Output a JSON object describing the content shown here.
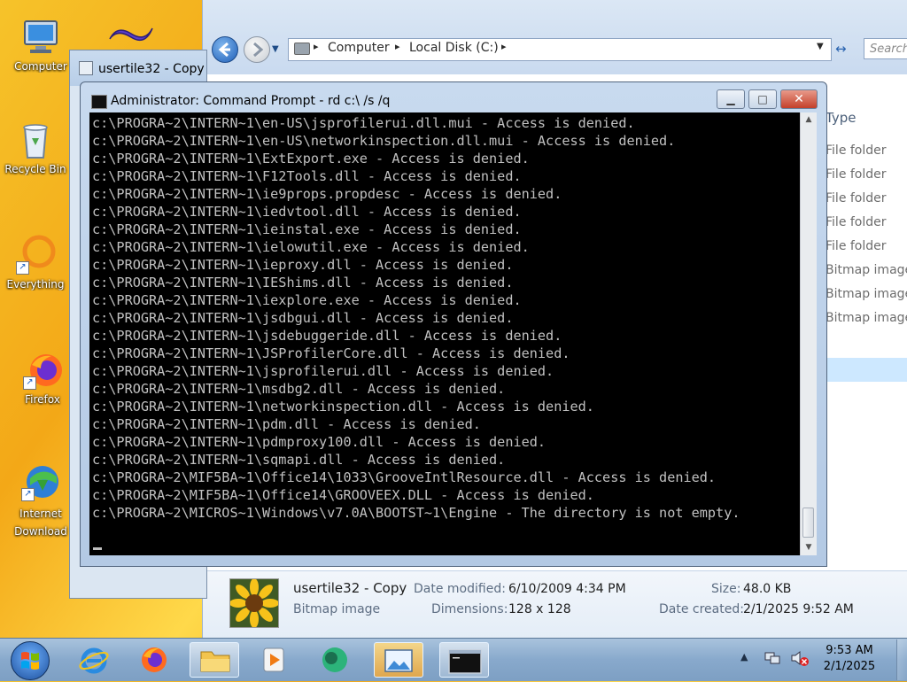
{
  "desktop": {
    "icons": [
      {
        "label": "Computer"
      },
      {
        "label": "Recycle Bin"
      },
      {
        "label": "Everything"
      },
      {
        "label": "Firefox"
      },
      {
        "label": "Internet Download"
      }
    ]
  },
  "explorer": {
    "breadcrumb": [
      "Computer",
      "Local Disk (C:)"
    ],
    "search_placeholder": "Search",
    "type_header": "Type",
    "types": [
      "File folder",
      "File folder",
      "File folder",
      "File folder",
      "File folder",
      "Bitmap image",
      "Bitmap image",
      "Bitmap image"
    ],
    "details": {
      "filename": "usertile32 - Copy",
      "filetype": "Bitmap image",
      "date_modified_label": "Date modified:",
      "date_modified": "6/10/2009 4:34 PM",
      "size_label": "Size:",
      "size": "48.0 KB",
      "dimensions_label": "Dimensions:",
      "dimensions": "128 x 128",
      "date_created_label": "Date created:",
      "date_created": "2/1/2025 9:52 AM"
    }
  },
  "copy_window": {
    "title": "usertile32 - Copy"
  },
  "cmd": {
    "title": "Administrator:  Command Prompt - rd  c:\\ /s /q",
    "lines": [
      "c:\\PROGRA~2\\INTERN~1\\en-US\\jsprofilerui.dll.mui - Access is denied.",
      "c:\\PROGRA~2\\INTERN~1\\en-US\\networkinspection.dll.mui - Access is denied.",
      "c:\\PROGRA~2\\INTERN~1\\ExtExport.exe - Access is denied.",
      "c:\\PROGRA~2\\INTERN~1\\F12Tools.dll - Access is denied.",
      "c:\\PROGRA~2\\INTERN~1\\ie9props.propdesc - Access is denied.",
      "c:\\PROGRA~2\\INTERN~1\\iedvtool.dll - Access is denied.",
      "c:\\PROGRA~2\\INTERN~1\\ieinstal.exe - Access is denied.",
      "c:\\PROGRA~2\\INTERN~1\\ielowutil.exe - Access is denied.",
      "c:\\PROGRA~2\\INTERN~1\\ieproxy.dll - Access is denied.",
      "c:\\PROGRA~2\\INTERN~1\\IEShims.dll - Access is denied.",
      "c:\\PROGRA~2\\INTERN~1\\iexplore.exe - Access is denied.",
      "c:\\PROGRA~2\\INTERN~1\\jsdbgui.dll - Access is denied.",
      "c:\\PROGRA~2\\INTERN~1\\jsdebuggeride.dll - Access is denied.",
      "c:\\PROGRA~2\\INTERN~1\\JSProfilerCore.dll - Access is denied.",
      "c:\\PROGRA~2\\INTERN~1\\jsprofilerui.dll - Access is denied.",
      "c:\\PROGRA~2\\INTERN~1\\msdbg2.dll - Access is denied.",
      "c:\\PROGRA~2\\INTERN~1\\networkinspection.dll - Access is denied.",
      "c:\\PROGRA~2\\INTERN~1\\pdm.dll - Access is denied.",
      "c:\\PROGRA~2\\INTERN~1\\pdmproxy100.dll - Access is denied.",
      "c:\\PROGRA~2\\INTERN~1\\sqmapi.dll - Access is denied.",
      "c:\\PROGRA~2\\MIF5BA~1\\Office14\\1033\\GrooveIntlResource.dll - Access is denied.",
      "c:\\PROGRA~2\\MIF5BA~1\\Office14\\GROOVEEX.DLL - Access is denied.",
      "c:\\PROGRA~2\\MICROS~1\\Windows\\v7.0A\\BOOTST~1\\Engine - The directory is not empty."
    ]
  },
  "taskbar": {
    "time": "9:53 AM",
    "date": "2/1/2025",
    "items": [
      "start-orb",
      "internet-explorer",
      "firefox",
      "file-explorer",
      "media-player",
      "network-app",
      "image-viewer",
      "command-prompt"
    ]
  },
  "colors": {
    "console_bg": "#000000",
    "console_fg": "#c0c0c0",
    "taskbar": "#88a9cc",
    "window_frame": "#b3c9e4"
  }
}
